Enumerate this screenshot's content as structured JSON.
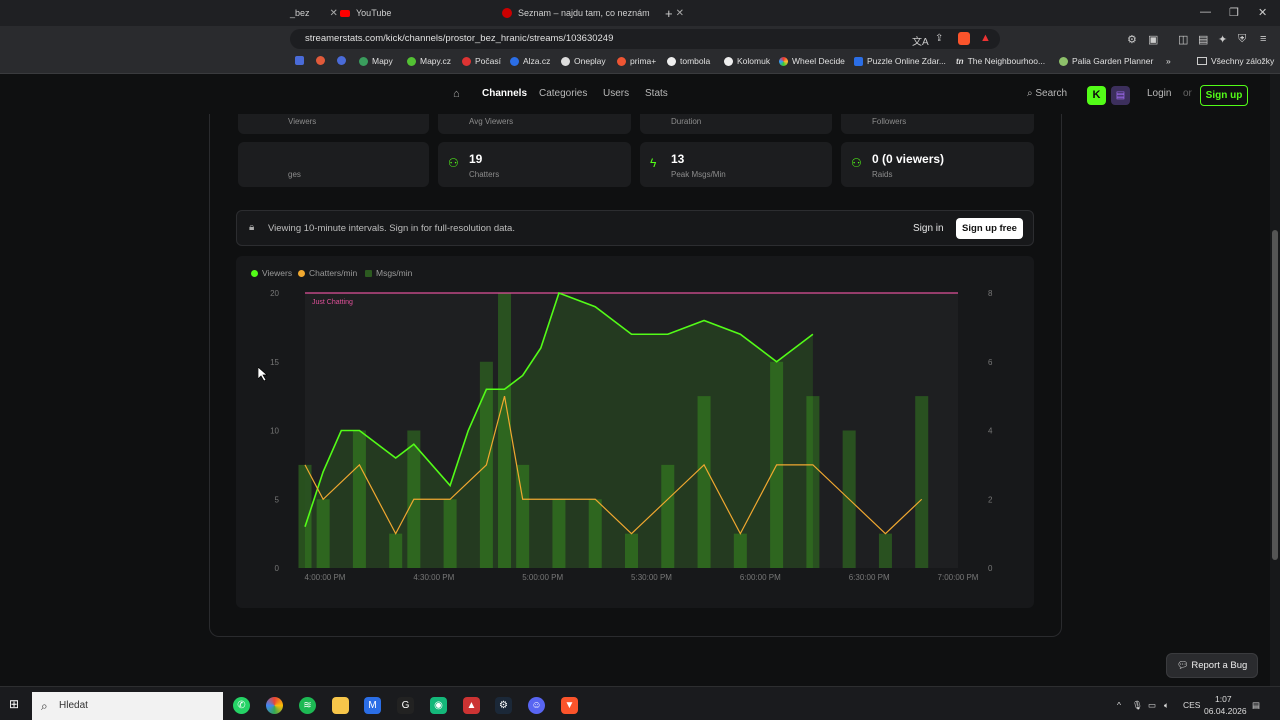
{
  "browser": {
    "tabs": [
      {
        "label": "_bez",
        "favicon": "kick"
      },
      {
        "label": "YouTube",
        "favicon": "youtube"
      },
      {
        "label": "Seznam – najdu tam, co neznám",
        "favicon": "seznam"
      }
    ],
    "url": "streamerstats.com/kick/channels/prostor_bez_hranic/streams/103630249",
    "bookmarks": [
      "Mapy",
      "Mapy.cz",
      "Počasí",
      "Alza.cz",
      "Oneplay",
      "prima+",
      "tombola",
      "Kolomuk",
      "Wheel Decide",
      "Puzzle Online Zdar...",
      "The Neighbourhoo...",
      "Palia Garden Planner",
      "Všechny záložky"
    ]
  },
  "nav": {
    "channels": "Channels",
    "categories": "Categories",
    "users": "Users",
    "stats": "Stats",
    "search": "Search",
    "login": "Login",
    "or": "or",
    "signup": "Sign up"
  },
  "top_stats": [
    {
      "label": "Viewers"
    },
    {
      "label": "Avg Viewers"
    },
    {
      "label": "Duration"
    },
    {
      "label": "Followers"
    }
  ],
  "stats": [
    {
      "value": "",
      "label": "ges"
    },
    {
      "value": "19",
      "label": "Chatters"
    },
    {
      "value": "13",
      "label": "Peak Msgs/Min"
    },
    {
      "value": "0 (0 viewers)",
      "label": "Raids"
    }
  ],
  "banner": {
    "text": "Viewing 10-minute intervals. Sign in for full-resolution data.",
    "sign_in": "Sign in",
    "signup_free": "Sign up free"
  },
  "legend": {
    "viewers": "Viewers",
    "chatters": "Chatters/min",
    "msgs": "Msgs/min"
  },
  "annotation": "Just Chatting",
  "chart_data": {
    "type": "line",
    "x": [
      "4:00:00 PM",
      "4:10:00 PM",
      "4:20:00 PM",
      "4:30:00 PM",
      "4:40:00 PM",
      "4:50:00 PM",
      "5:00:00 PM",
      "5:10:00 PM",
      "5:20:00 PM",
      "5:30:00 PM",
      "5:40:00 PM",
      "5:50:00 PM",
      "6:00:00 PM",
      "6:10:00 PM",
      "6:20:00 PM",
      "6:30:00 PM",
      "6:40:00 PM",
      "6:50:00 PM",
      "7:00:00 PM"
    ],
    "x_ticks": [
      "4:00:00 PM",
      "4:30:00 PM",
      "5:00:00 PM",
      "5:30:00 PM",
      "6:00:00 PM",
      "6:30:00 PM",
      "7:00:00 PM"
    ],
    "y_left_ticks": [
      "0",
      "5",
      "10",
      "15",
      "20"
    ],
    "y_right_ticks": [
      "0",
      "2",
      "4",
      "6",
      "8"
    ],
    "ylim_left": [
      0,
      20
    ],
    "ylim_right": [
      0,
      8
    ],
    "viewers_x": [
      0,
      0.5,
      1,
      1.5,
      2.5,
      3,
      4,
      4.5,
      5,
      5.5,
      6,
      6.5,
      7,
      8,
      9,
      10,
      11,
      12,
      13,
      14,
      15,
      16,
      17,
      18
    ],
    "viewers": [
      3,
      7,
      10,
      10,
      8,
      9,
      6,
      10,
      13,
      13,
      14,
      16,
      20,
      19,
      17,
      17,
      18,
      17,
      15,
      17
    ],
    "chatters_x": [
      0,
      0.5,
      1.5,
      2.5,
      3,
      4,
      5,
      5.5,
      6,
      7,
      8,
      9,
      10,
      11,
      12,
      13,
      14,
      15,
      16,
      17,
      18
    ],
    "chatters": [
      3,
      2,
      3,
      1,
      2,
      2,
      3,
      5,
      2,
      2,
      2,
      1,
      2,
      3,
      1,
      3,
      3,
      2,
      1,
      2
    ],
    "msgs_x": [
      0,
      0.5,
      1.5,
      2.5,
      3,
      4,
      5,
      5.5,
      6,
      7,
      8,
      9,
      10,
      11,
      12,
      13,
      14,
      15,
      16,
      17,
      18
    ],
    "msgs": [
      3,
      2,
      4,
      1,
      4,
      2,
      6,
      8,
      3,
      2,
      2,
      1,
      3,
      5,
      1,
      6,
      5,
      4,
      1,
      5
    ],
    "series_colors": {
      "viewers": "#53fc18",
      "chatters": "#f0a830",
      "msgs": "#2c5a20"
    }
  },
  "report_bug": "Report a Bug",
  "taskbar": {
    "search_placeholder": "Hledat",
    "lang": "CES",
    "time": "1:07",
    "date": "06.04.2026"
  }
}
